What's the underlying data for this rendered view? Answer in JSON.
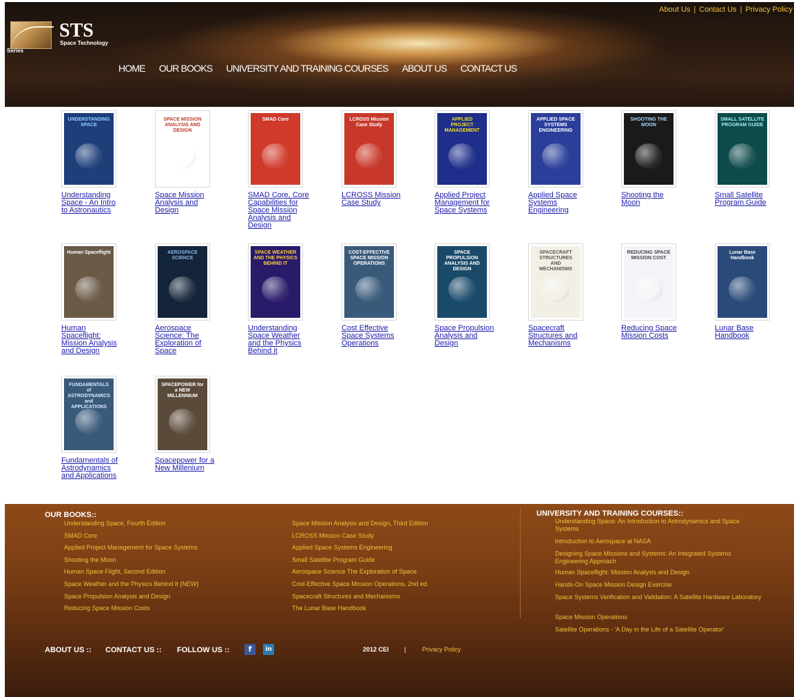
{
  "top_links": [
    "About Us",
    "Contact Us",
    "Privacy Policy"
  ],
  "logo": {
    "series": "Series",
    "name": "STS",
    "sub": "Space Technology"
  },
  "nav": [
    "HOME",
    "OUR BOOKS",
    "UNIVERSITY AND TRAINING COURSES",
    "ABOUT US",
    "CONTACT US"
  ],
  "books": [
    {
      "label": "Understanding Space - An Intro to Astronautics",
      "cover_text": "UNDERSTANDING SPACE",
      "bg": "#1e3e7a",
      "fg": "#8fd0ff"
    },
    {
      "label": "Space Mission Analysis and Design",
      "cover_text": "SPACE MISSION ANALYSIS AND DESIGN",
      "bg": "#ffffff",
      "fg": "#c03a2a"
    },
    {
      "label": "SMAD Core, Core Capabilities for Space Mission Analysis and Design",
      "cover_text": "SMAD Core",
      "bg": "#d03a2a",
      "fg": "#ffffff"
    },
    {
      "label": "LCROSS Mission Case Study",
      "cover_text": "LCROSS Mission Case Study",
      "bg": "#c8382a",
      "fg": "#ffffff"
    },
    {
      "label": "Applied Project Management for Space Systems",
      "cover_text": "APPLIED PROJECT MANAGEMENT",
      "bg": "#1e2e8a",
      "fg": "#f0e020"
    },
    {
      "label": "Applied Space Systems Engineering",
      "cover_text": "APPLIED SPACE SYSTEMS ENGINEERING",
      "bg": "#2a3e9a",
      "fg": "#ffffff"
    },
    {
      "label": "Shooting the Moon",
      "cover_text": "SHOOTING THE MOON",
      "bg": "#1a1a1a",
      "fg": "#a8d8ff"
    },
    {
      "label": "Small Satellite Program Guide",
      "cover_text": "SMALL SATELLITE PROGRAM GUIDE",
      "bg": "#0e4a4a",
      "fg": "#a0f0f0"
    },
    {
      "label": "Human Spaceflight: Mission Analysis and Design",
      "cover_text": "Human Spaceflight",
      "bg": "#6a5a48",
      "fg": "#ffffff"
    },
    {
      "label": "Aerospace Science: The Exploration of Space",
      "cover_text": "AEROSPACE SCIENCE",
      "bg": "#14243a",
      "fg": "#8ab8e8"
    },
    {
      "label": "Understanding Space Weather and the Physics Behind it",
      "cover_text": "SPACE WEATHER AND THE PHYSICS BEHIND IT",
      "bg": "#2a1a6a",
      "fg": "#ffd040"
    },
    {
      "label": "Cost Effective Space Systems Operations",
      "cover_text": "COST-EFFECTIVE SPACE MISSION OPERATIONS",
      "bg": "#3a5a7a",
      "fg": "#ffffff"
    },
    {
      "label": "Space Propulsion Analysis and Design",
      "cover_text": "SPACE PROPULSION ANALYSIS AND DESIGN",
      "bg": "#1a4a6a",
      "fg": "#ffffff"
    },
    {
      "label": "Spacecraft Structures and Mechanisms",
      "cover_text": "SPACECRAFT STRUCTURES AND MECHANISMS",
      "bg": "#f2efe6",
      "fg": "#555555"
    },
    {
      "label": "Reducing Space Mission Costs",
      "cover_text": "REDUCING SPACE MISSION COST",
      "bg": "#f4f4f8",
      "fg": "#444444"
    },
    {
      "label": "Lunar Base Handbook",
      "cover_text": "Lunar Base Handbook",
      "bg": "#2a4a7a",
      "fg": "#ffffff"
    },
    {
      "label": "Fundamentals of Astrodynamics and Applications",
      "cover_text": "FUNDAMENTALS of ASTRODYNAMICS and APPLICATIONS",
      "bg": "#3a5a7a",
      "fg": "#d8e8ff"
    },
    {
      "label": "Spacepower for a New Millenium",
      "cover_text": "SPACEPOWER for a NEW MILLENNIUM",
      "bg": "#5a4a3a",
      "fg": "#ffffff"
    }
  ],
  "footer": {
    "books_heading": "OUR BOOKS::",
    "books_col1": [
      "Understanding Space, Fourth Edition",
      "SMAD Core",
      "Applied Project Management for Space Systems",
      "Shooting the Moon",
      "Human Space Flight, Second Edition",
      "Space Weather and the Physics Behind It (NEW)",
      "Space Propulsion Analysis and Design",
      "Reducing Space Mission Costs"
    ],
    "books_col2": [
      "Space Mission Analysis and Design, Third Edition",
      "LCROSS Mission Case Study",
      "Applied Space Systems Engineering",
      "Small Satellite Program Guide",
      "Aerospace Science The Exploration of Space",
      "Cost-Effective Space Mission Operations, 2nd ed.",
      "Spacecraft Structures and Mechanisms",
      "The Lunar Base Handbook"
    ],
    "courses_heading": "UNIVERSITY AND TRAINING COURSES::",
    "courses": [
      "Understanding Space: An Introduction to Astrodynamics and Space Systems",
      "Introduction to Aerospace at NASA",
      "Designing Space Missions and Systems: An Integrated Systems Engineering Approach",
      "Human Spaceflight: Mission Analysis and Design",
      "Hands-On Space Mission Design Exercise",
      "Space Systems Verification and Validation: A Satellite Hardware Laboratory",
      "Space Mission Operations",
      "Satellite Operations - 'A Day in the Life of a Satellite Operator'"
    ],
    "about": "ABOUT US ::",
    "contact": "CONTACT US ::",
    "follow": "FOLLOW US ::",
    "facebook_glyph": "f",
    "linkedin_glyph": "in",
    "copyright": "2012 CEI",
    "bar": "|",
    "privacy": "Privacy Policy"
  }
}
